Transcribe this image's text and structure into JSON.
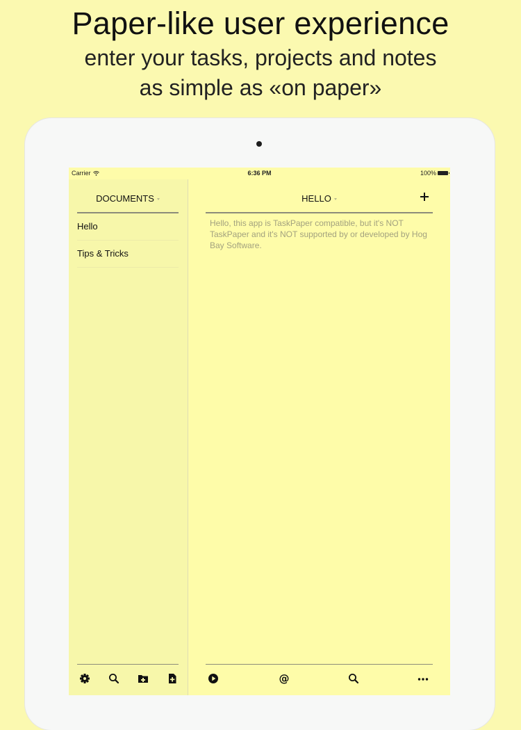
{
  "promo": {
    "title": "Paper-like user experience",
    "subtitle_line1": "enter your tasks, projects and notes",
    "subtitle_line2": "as simple as «on paper»"
  },
  "status_bar": {
    "carrier": "Carrier",
    "time": "6:36 PM",
    "battery": "100%"
  },
  "sidebar": {
    "header": "DOCUMENTS",
    "items": [
      {
        "label": "Hello"
      },
      {
        "label": "Tips & Tricks"
      }
    ],
    "toolbar_icons": [
      "gear-icon",
      "search-icon",
      "folder-icon",
      "new-document-icon"
    ]
  },
  "editor": {
    "title": "HELLO",
    "body": "Hello, this app is TaskPaper compatible, but it's NOT TaskPaper and it's NOT supported by or developed by Hog Bay Software.",
    "toolbar_icons": [
      "play-icon",
      "at-sign-icon",
      "search-icon",
      "more-icon"
    ]
  },
  "colors": {
    "page_background": "#fbf9b0",
    "screen_background": "#fefca9",
    "sidebar_background": "#f7f7aa",
    "body_text": "#a3a27f"
  }
}
